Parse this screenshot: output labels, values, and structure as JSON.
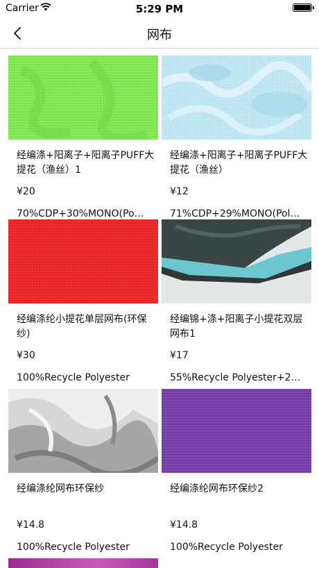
{
  "status_bar": {
    "carrier": "Carrier",
    "time": "5:29 PM"
  },
  "nav": {
    "title": "网布"
  },
  "products": [
    {
      "name": "经编涤+阳离子+阳离子PUFF大提花（渔丝）1",
      "price": "¥20",
      "composition": "70%CDP+30%MONO(Po…",
      "image": {
        "kind": "solid-mesh",
        "colors": [
          "#86e85a",
          "#6fd142"
        ]
      }
    },
    {
      "name": "经编涤+阳离子+阳离子PUFF大提花（渔丝）",
      "price": "¥12",
      "composition": "71%CDP+29%MONO(Pol…",
      "image": {
        "kind": "jacquard",
        "colors": [
          "#bfe6f4",
          "#9fd4ea"
        ]
      }
    },
    {
      "name": "经编涤纶小提花单层网布(环保纱)",
      "price": "¥30",
      "composition": "100%Recycle Polyester",
      "image": {
        "kind": "solid-mesh",
        "colors": [
          "#ee2b2e",
          "#c91c22"
        ]
      }
    },
    {
      "name": "经编锦+涤+阳离子小提花双层网布1",
      "price": "¥17",
      "composition": "55%Recycle Polyester+2…",
      "image": {
        "kind": "folded-fabric",
        "colors": [
          "#3c4a4a",
          "#6cc6cf",
          "#e2e6e6"
        ]
      }
    },
    {
      "name": "经编涤纶网布环保纱",
      "price": "¥14.8",
      "composition": "100%Recycle Polyester",
      "image": {
        "kind": "crumpled",
        "colors": [
          "#d8d8d8",
          "#8e8e8e",
          "#f2f2f2"
        ]
      }
    },
    {
      "name": "经编涤纶网布环保纱2",
      "price": "¥14.8",
      "composition": "100%Recycle Polyester",
      "image": {
        "kind": "ribbed",
        "colors": [
          "#7e48b2",
          "#5c2e8f"
        ]
      }
    }
  ]
}
